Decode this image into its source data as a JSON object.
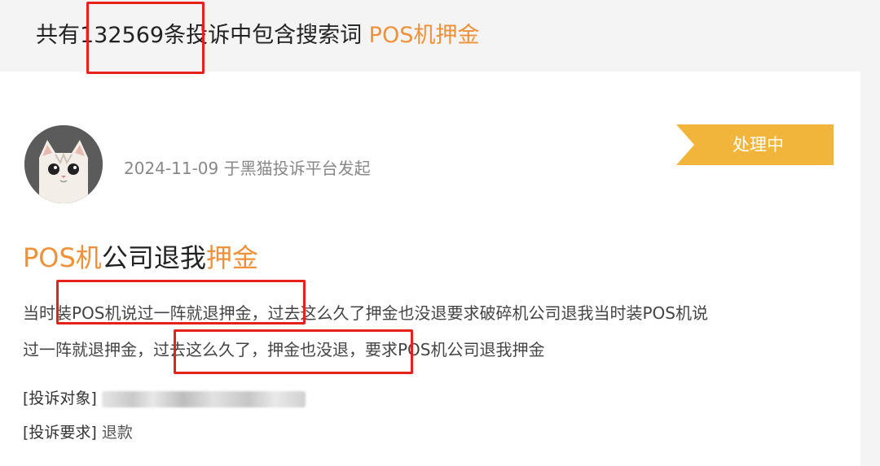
{
  "header": {
    "prefix": "共有",
    "count": "132569",
    "suffix": "条投诉中包含搜索词 ",
    "keyword": "POS机押金"
  },
  "complaint": {
    "date_source": "2024-11-09 于黑猫投诉平台发起",
    "status": "处理中",
    "title_parts": {
      "kw1": "POS机",
      "mid": "公司退我",
      "kw2": "押金"
    },
    "content_line1": "当时装POS机说过一阵就退押金，过去这么久了押金也没退要求破碎机公司退我当时装POS机说",
    "content_line2": "过一阵就退押金，过去这么久了，押金也没退，要求POS机公司退我押金",
    "target_label": "[投诉对象]",
    "demand_label": "[投诉要求]",
    "demand_value": "退款"
  },
  "colors": {
    "accent": "#f0913a",
    "status_bg": "#f2b53c",
    "highlight_box": "#e8201a"
  },
  "icons": {
    "avatar": "cat-avatar-icon"
  }
}
